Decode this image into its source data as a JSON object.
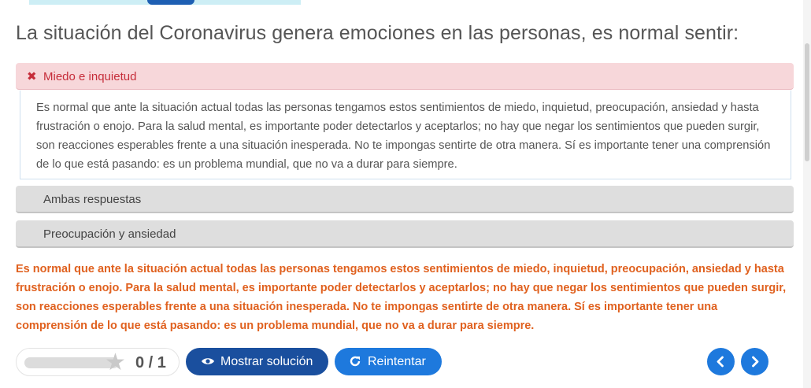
{
  "question": {
    "title": "La situación del Coronavirus genera emociones en las personas, es normal sentir:"
  },
  "alternatives": [
    {
      "label": "Miedo e inquietud",
      "state": "wrong",
      "icon": "x-icon"
    },
    {
      "label": "Ambas respuestas",
      "state": "neutral"
    },
    {
      "label": "Preocupación y ansiedad",
      "state": "neutral"
    }
  ],
  "tip": {
    "text": "Es normal que ante la situación actual todas las personas tengamos estos sentimientos de miedo, inquietud, preocupación, ansiedad y hasta frustración o enojo. Para la salud mental, es importante poder detectarlos y aceptarlos; no hay que negar los sentimientos que pueden surgir, son reacciones esperables frente a una situación inesperada. No te impongas sentirte de otra manera. Sí es importante tener una comprensión de lo que está pasando: es un problema mundial, que no va a durar para siempre."
  },
  "feedback": {
    "text": "Es normal que ante la situación actual todas las personas tengamos estos sentimientos de miedo, inquietud, preocupación, ansiedad y hasta frustración o enojo. Para la salud mental, es importante poder detectarlos y aceptarlos; no hay que negar los sentimientos que pueden surgir, son reacciones esperables frente a una situación inesperada. No te impongas sentirte de otra manera. Sí es importante tener una comprensión de lo que está pasando: es un problema mundial, que no va a durar para siempre."
  },
  "score": {
    "text": "0 / 1",
    "progress": 0
  },
  "buttons": {
    "show_solution": "Mostrar solución",
    "retry": "Reintentar"
  },
  "colors": {
    "wrong_bg": "#f7d7da",
    "wrong_text": "#c62d3a",
    "feedback": "#e0611f",
    "primary_dark": "#1a4f9e",
    "primary": "#1e79dd"
  }
}
